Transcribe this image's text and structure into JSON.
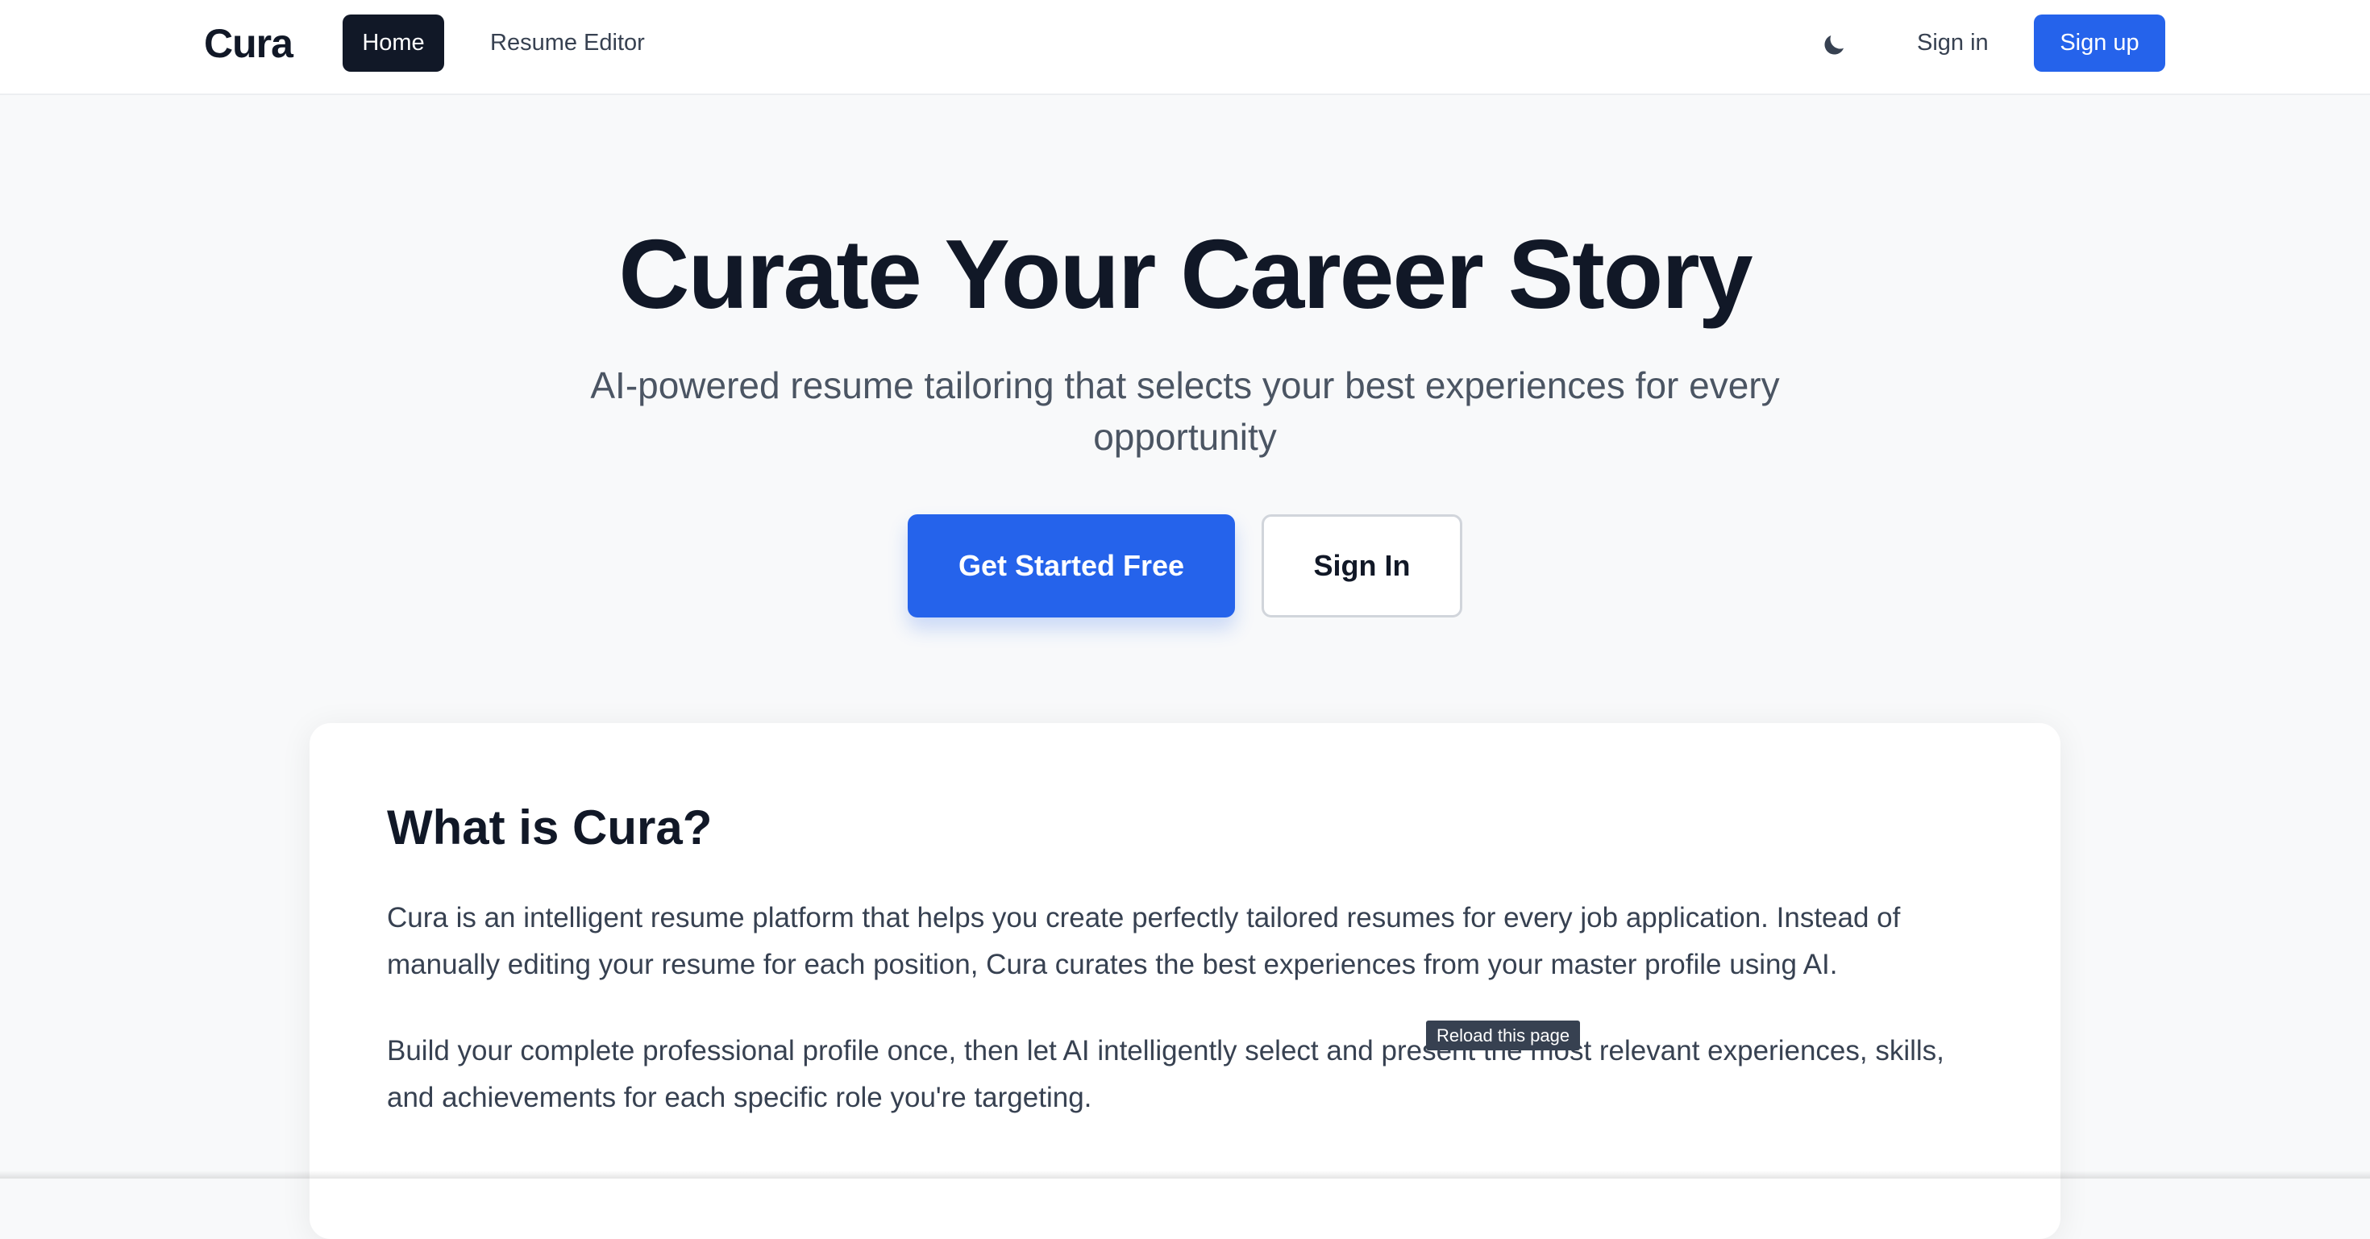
{
  "navbar": {
    "brand": "Cura",
    "links": {
      "home": "Home",
      "resume_editor": "Resume Editor"
    },
    "theme_icon": "moon-icon",
    "sign_in": "Sign in",
    "sign_up": "Sign up"
  },
  "hero": {
    "title": "Curate Your Career Story",
    "subtitle": "AI-powered resume tailoring that selects your best experiences for every opportunity",
    "primary_cta": "Get Started Free",
    "secondary_cta": "Sign In"
  },
  "about": {
    "title": "What is Cura?",
    "paragraphs": [
      "Cura is an intelligent resume platform that helps you create perfectly tailored resumes for every job application. Instead of manually editing your resume for each position, Cura curates the best experiences from your master profile using AI.",
      "Build your complete professional profile once, then let AI intelligently select and present the most relevant experiences, skills, and achievements for each specific role you're targeting."
    ]
  },
  "tooltip": {
    "text": "Reload this page"
  },
  "colors": {
    "accent": "#2563eb",
    "dark": "#111827",
    "page_background": "#f8f9fa"
  }
}
